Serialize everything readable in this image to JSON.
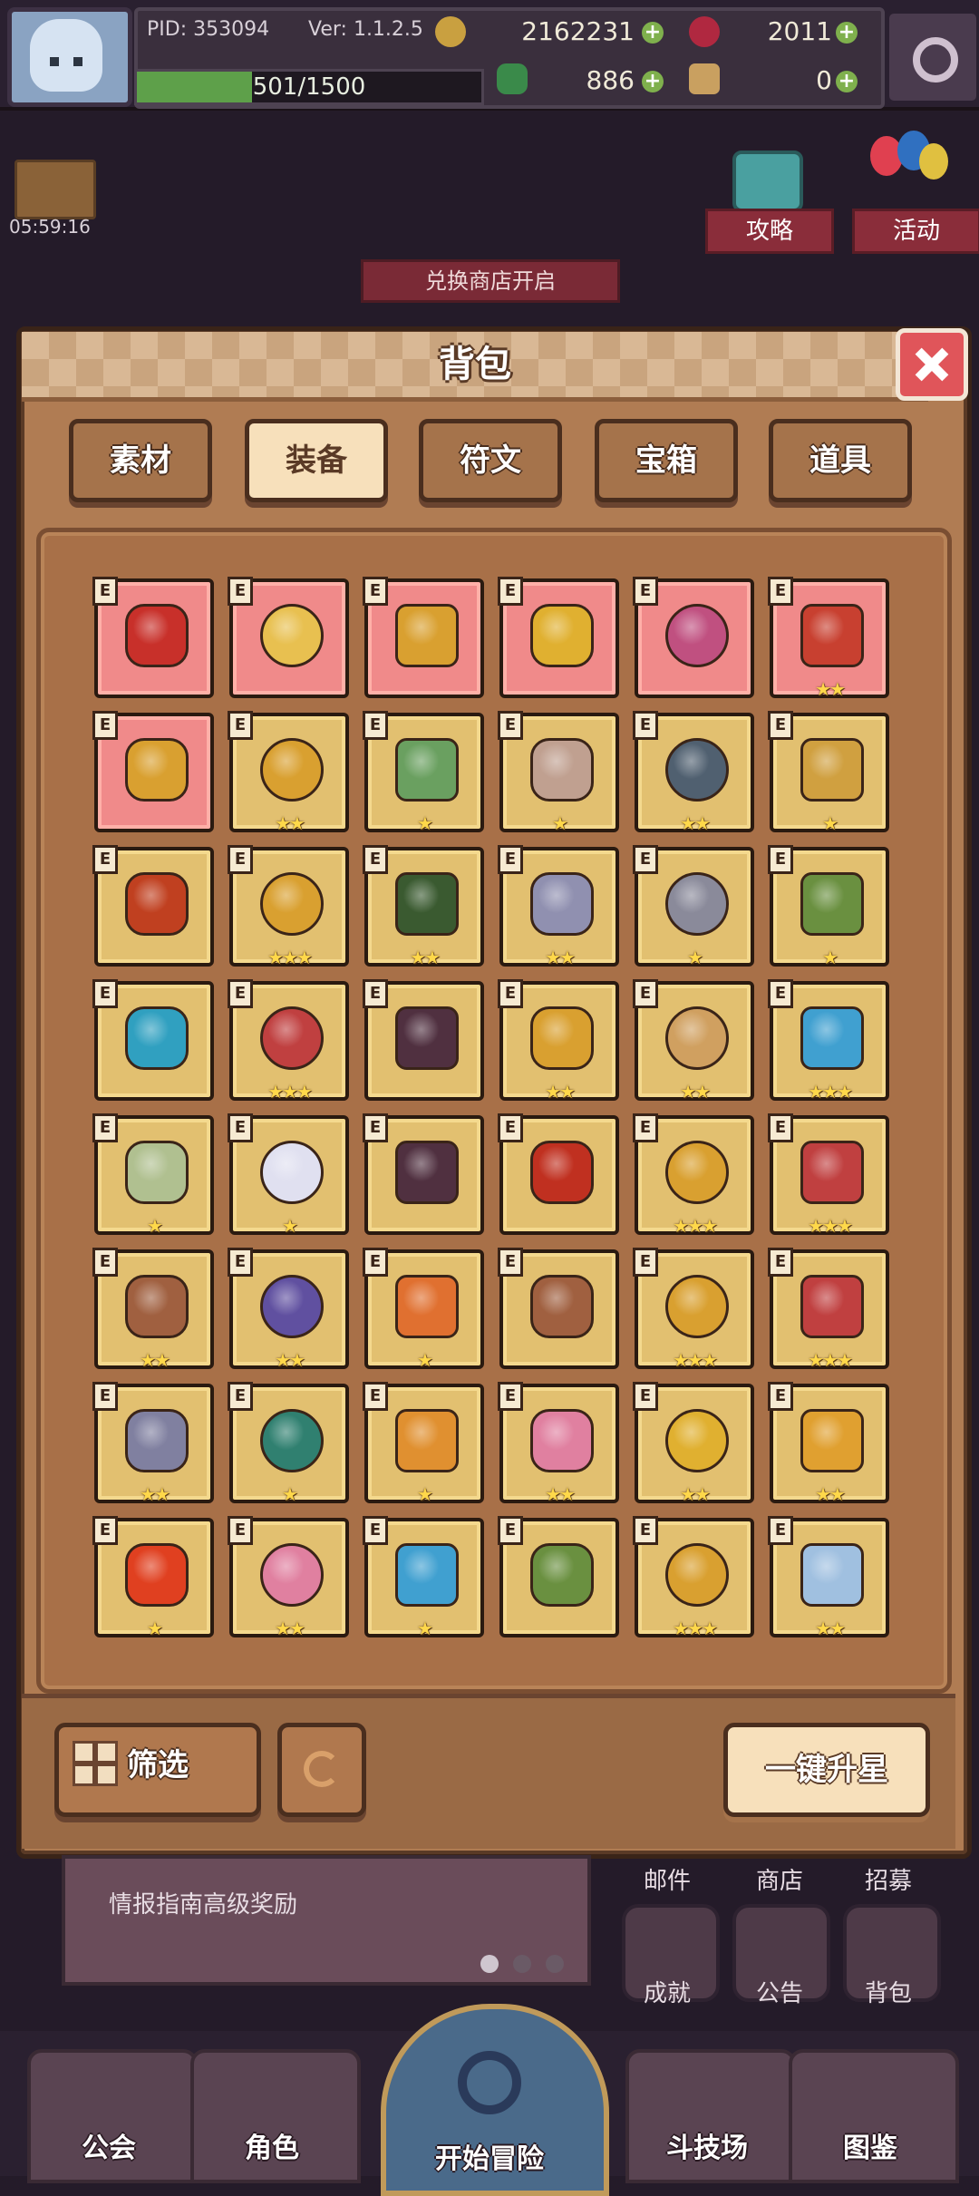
{
  "header": {
    "pid_label": "PID: 353094",
    "version_label": "Ver: 1.1.2.5",
    "gold": "2162231",
    "gems": "2011",
    "xp_text": "501/1500",
    "xp_progress": 0.334,
    "clover": "886",
    "thumb": "0"
  },
  "hud": {
    "timer": "05:59:16",
    "guide_label": "攻略",
    "event_label": "活动",
    "shop_banner": "兑换商店开启"
  },
  "modal": {
    "title": "背包",
    "tabs": [
      {
        "label": "素材",
        "active": false
      },
      {
        "label": "装备",
        "active": true
      },
      {
        "label": "符文",
        "active": false
      },
      {
        "label": "宝箱",
        "active": false
      },
      {
        "label": "道具",
        "active": false
      }
    ],
    "badge_letter": "E",
    "filter_label": "筛选",
    "upstar_label": "一键升星"
  },
  "items": [
    {
      "icon": "crossed-blades-icon",
      "rarity": "red",
      "stars": 0,
      "color": "#c8302a"
    },
    {
      "icon": "straw-hat-icon",
      "rarity": "red",
      "stars": 0,
      "color": "#e8c050"
    },
    {
      "icon": "golden-circlet-icon",
      "rarity": "red",
      "stars": 0,
      "color": "#d9a030"
    },
    {
      "icon": "gold-pendant-icon",
      "rarity": "red",
      "stars": 0,
      "color": "#e0b030"
    },
    {
      "icon": "pink-vest-icon",
      "rarity": "red",
      "stars": 0,
      "color": "#c05080"
    },
    {
      "icon": "red-bracer-icon",
      "rarity": "red",
      "stars": 2,
      "color": "#c84030"
    },
    {
      "icon": "gold-ring-icon",
      "rarity": "red",
      "stars": 0,
      "color": "#d9a030"
    },
    {
      "icon": "golden-staff-icon",
      "rarity": "gold",
      "stars": 2,
      "color": "#d9a030"
    },
    {
      "icon": "jade-sword-icon",
      "rarity": "gold",
      "stars": 1,
      "color": "#6aa060"
    },
    {
      "icon": "battle-axe-icon",
      "rarity": "gold",
      "stars": 1,
      "color": "#c0a090"
    },
    {
      "icon": "spear-icon",
      "rarity": "gold",
      "stars": 2,
      "color": "#506070"
    },
    {
      "icon": "crystal-shield-icon",
      "rarity": "gold",
      "stars": 1,
      "color": "#d0a040"
    },
    {
      "icon": "lantern-armor-icon",
      "rarity": "gold",
      "stars": 0,
      "color": "#c04020"
    },
    {
      "icon": "gold-band-icon",
      "rarity": "gold",
      "stars": 3,
      "color": "#d9a030"
    },
    {
      "icon": "green-hood-icon",
      "rarity": "gold",
      "stars": 2,
      "color": "#3a5a30"
    },
    {
      "icon": "winged-crown-icon",
      "rarity": "gold",
      "stars": 2,
      "color": "#9090b0"
    },
    {
      "icon": "grey-hood-icon",
      "rarity": "gold",
      "stars": 1,
      "color": "#8a8a9a"
    },
    {
      "icon": "green-collar-icon",
      "rarity": "gold",
      "stars": 1,
      "color": "#6a9040"
    },
    {
      "icon": "cyan-scarf-icon",
      "rarity": "gold",
      "stars": 0,
      "color": "#30a0c0"
    },
    {
      "icon": "royal-robe-icon",
      "rarity": "gold",
      "stars": 3,
      "color": "#c04040"
    },
    {
      "icon": "demon-armor-icon",
      "rarity": "gold",
      "stars": 0,
      "color": "#503040"
    },
    {
      "icon": "gold-chestplate-icon",
      "rarity": "gold",
      "stars": 2,
      "color": "#d9a030"
    },
    {
      "icon": "bone-bracer-icon",
      "rarity": "gold",
      "stars": 2,
      "color": "#d0a060"
    },
    {
      "icon": "blue-cape-icon",
      "rarity": "gold",
      "stars": 3,
      "color": "#40a0d0"
    },
    {
      "icon": "feather-glove-icon",
      "rarity": "gold",
      "stars": 1,
      "color": "#b0c090"
    },
    {
      "icon": "angel-glove-icon",
      "rarity": "gold",
      "stars": 1,
      "color": "#e0e0f0"
    },
    {
      "icon": "demon-gauntlet-icon",
      "rarity": "gold",
      "stars": 0,
      "color": "#503040"
    },
    {
      "icon": "lava-glove-icon",
      "rarity": "gold",
      "stars": 0,
      "color": "#c03020"
    },
    {
      "icon": "jeweled-bracelet-icon",
      "rarity": "gold",
      "stars": 3,
      "color": "#d9a030"
    },
    {
      "icon": "ruby-bracelet-icon",
      "rarity": "gold",
      "stars": 3,
      "color": "#c04040"
    },
    {
      "icon": "amethyst-ring-icon",
      "rarity": "gold",
      "stars": 2,
      "color": "#a06040"
    },
    {
      "icon": "violet-bracelet-icon",
      "rarity": "gold",
      "stars": 2,
      "color": "#6050a0"
    },
    {
      "icon": "orange-ring-icon",
      "rarity": "gold",
      "stars": 1,
      "color": "#e07030"
    },
    {
      "icon": "diamond-band-icon",
      "rarity": "gold",
      "stars": 0,
      "color": "#a06040"
    },
    {
      "icon": "gold-boots-icon",
      "rarity": "gold",
      "stars": 3,
      "color": "#d9a030"
    },
    {
      "icon": "crimson-boots-icon",
      "rarity": "gold",
      "stars": 3,
      "color": "#c04040"
    },
    {
      "icon": "iron-boots-icon",
      "rarity": "gold",
      "stars": 2,
      "color": "#8080a0"
    },
    {
      "icon": "teal-boots-icon",
      "rarity": "gold",
      "stars": 1,
      "color": "#308070"
    },
    {
      "icon": "sun-boots-icon",
      "rarity": "gold",
      "stars": 1,
      "color": "#e09030"
    },
    {
      "icon": "heart-wings-icon",
      "rarity": "gold",
      "stars": 2,
      "color": "#e080a0"
    },
    {
      "icon": "sun-amulet-icon",
      "rarity": "gold",
      "stars": 2,
      "color": "#e0b030"
    },
    {
      "icon": "flower-amulet-icon",
      "rarity": "gold",
      "stars": 2,
      "color": "#e0a030"
    },
    {
      "icon": "fire-star-icon",
      "rarity": "gold",
      "stars": 1,
      "color": "#e04020"
    },
    {
      "icon": "heart-necklace-icon",
      "rarity": "gold",
      "stars": 2,
      "color": "#e080a0"
    },
    {
      "icon": "blue-heart-icon",
      "rarity": "gold",
      "stars": 1,
      "color": "#40a0d0"
    },
    {
      "icon": "green-heart-icon",
      "rarity": "gold",
      "stars": 0,
      "color": "#6a9040"
    },
    {
      "icon": "gold-locket-icon",
      "rarity": "gold",
      "stars": 3,
      "color": "#d9a030"
    },
    {
      "icon": "crystal-drop-icon",
      "rarity": "gold",
      "stars": 2,
      "color": "#a0c0e0"
    }
  ],
  "lower_hud": {
    "news_sub": "情报指南高级奖励",
    "mail": "邮件",
    "shop": "商店",
    "recruit": "招募",
    "achieve": "成就",
    "notice": "公告",
    "bag": "背包"
  },
  "nav": {
    "guild": "公会",
    "role": "角色",
    "adventure": "开始冒险",
    "arena": "斗技场",
    "codex": "图鉴"
  },
  "colors": {
    "rarity_red": "#f08a8a",
    "rarity_gold": "#e2c070",
    "star": "#ffd84a",
    "accent_close": "#e0555a"
  }
}
